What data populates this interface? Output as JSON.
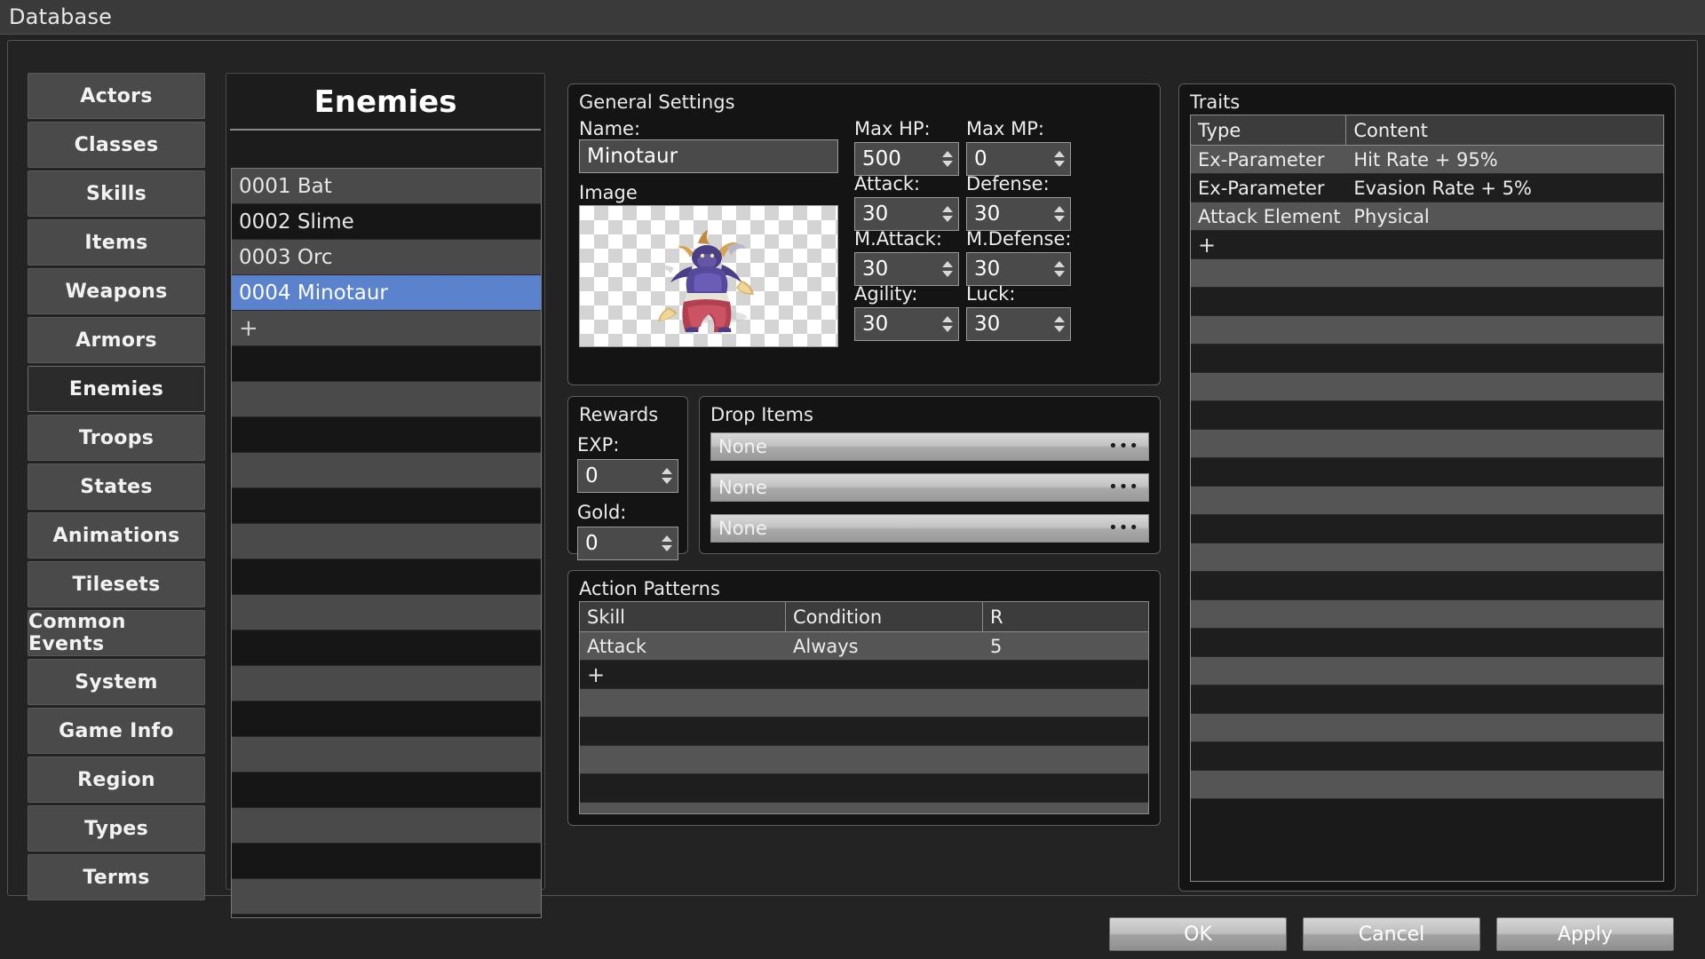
{
  "window": {
    "title": "Database"
  },
  "sidebar": {
    "items": [
      {
        "label": "Actors",
        "selected": false
      },
      {
        "label": "Classes",
        "selected": false
      },
      {
        "label": "Skills",
        "selected": false
      },
      {
        "label": "Items",
        "selected": false
      },
      {
        "label": "Weapons",
        "selected": false
      },
      {
        "label": "Armors",
        "selected": false
      },
      {
        "label": "Enemies",
        "selected": true
      },
      {
        "label": "Troops",
        "selected": false
      },
      {
        "label": "States",
        "selected": false
      },
      {
        "label": "Animations",
        "selected": false
      },
      {
        "label": "Tilesets",
        "selected": false
      },
      {
        "label": "Common Events",
        "selected": false
      },
      {
        "label": "System",
        "selected": false
      },
      {
        "label": "Game Info",
        "selected": false
      },
      {
        "label": "Region",
        "selected": false
      },
      {
        "label": "Types",
        "selected": false
      },
      {
        "label": "Terms",
        "selected": false
      }
    ]
  },
  "list_panel": {
    "title": "Enemies",
    "add_label": "+",
    "entries": [
      {
        "label": "0001 Bat",
        "selected": false
      },
      {
        "label": "0002 Slime",
        "selected": false
      },
      {
        "label": "0003 Orc",
        "selected": false
      },
      {
        "label": "0004 Minotaur",
        "selected": true
      }
    ],
    "empty_row_count": 16
  },
  "general_settings": {
    "group_label": "General Settings",
    "name_label": "Name:",
    "name_value": "Minotaur",
    "name_placeholder": "Name",
    "image_label": "Image",
    "image_alt": "minotaur-battler-sprite",
    "stats": [
      {
        "label": "Max HP:",
        "value": "500"
      },
      {
        "label": "Max MP:",
        "value": "0"
      },
      {
        "label": "Attack:",
        "value": "30"
      },
      {
        "label": "Defense:",
        "value": "30"
      },
      {
        "label": "M.Attack:",
        "value": "30"
      },
      {
        "label": "M.Defense:",
        "value": "30"
      },
      {
        "label": "Agility:",
        "value": "30"
      },
      {
        "label": "Luck:",
        "value": "30"
      }
    ]
  },
  "rewards": {
    "group_label": "Rewards",
    "exp_label": "EXP:",
    "exp_value": "0",
    "gold_label": "Gold:",
    "gold_value": "0"
  },
  "drop_items": {
    "group_label": "Drop Items",
    "browse_glyph": "•••",
    "items": [
      {
        "value": "None"
      },
      {
        "value": "None"
      },
      {
        "value": "None"
      }
    ]
  },
  "action_patterns": {
    "group_label": "Action Patterns",
    "columns": [
      "Skill",
      "Condition",
      "R"
    ],
    "rows": [
      {
        "skill": "Attack",
        "condition": "Always",
        "rating": "5"
      }
    ],
    "add_label": "+",
    "empty_row_count": 5
  },
  "traits": {
    "group_label": "Traits",
    "columns": [
      "Type",
      "Content"
    ],
    "rows": [
      {
        "type": "Ex-Parameter",
        "content": "Hit Rate + 95%"
      },
      {
        "type": "Ex-Parameter",
        "content": "Evasion Rate + 5%"
      },
      {
        "type": "Attack Element",
        "content": "Physical"
      }
    ],
    "add_label": "+",
    "empty_row_count": 19
  },
  "footer": {
    "ok_label": "OK",
    "cancel_label": "Cancel",
    "apply_label": "Apply"
  },
  "colors": {
    "selection_blue": "#5a82cd",
    "panel_background": "#141414",
    "row_light": "#4a4a4a",
    "row_dark": "#161616",
    "text": "#ececec"
  }
}
